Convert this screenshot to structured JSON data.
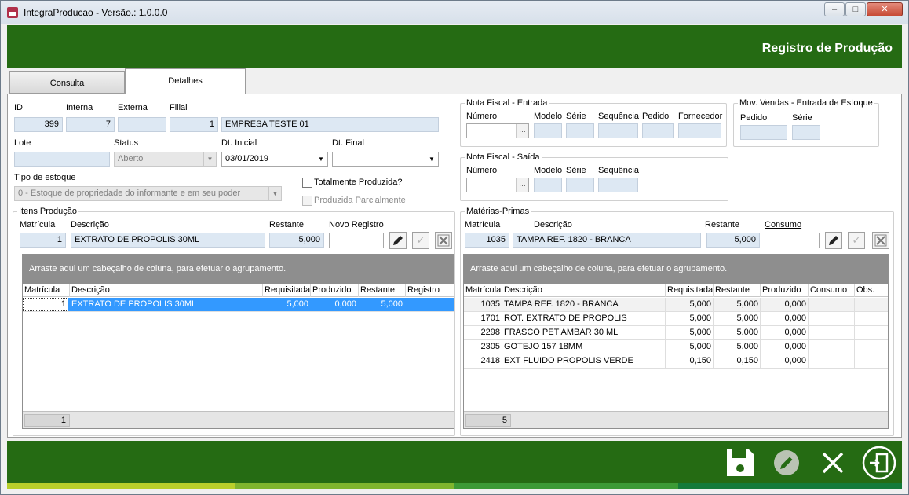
{
  "window": {
    "title": "IntegraProducao - Versão.: 1.0.0.0",
    "min": "–",
    "max": "□",
    "close": "✕"
  },
  "header": {
    "title": "Registro de Produção"
  },
  "tabs": [
    {
      "label": "Consulta"
    },
    {
      "label": "Detalhes"
    }
  ],
  "form": {
    "id": {
      "label": "ID",
      "value": "399"
    },
    "interna": {
      "label": "Interna",
      "value": "7"
    },
    "externa": {
      "label": "Externa",
      "value": ""
    },
    "filial": {
      "label": "Filial",
      "value": "1",
      "name": "EMPRESA TESTE 01"
    },
    "lote": {
      "label": "Lote",
      "value": ""
    },
    "status": {
      "label": "Status",
      "value": "Aberto"
    },
    "dt_inicial": {
      "label": "Dt. Inicial",
      "value": "03/01/2019"
    },
    "dt_final": {
      "label": "Dt. Final",
      "value": ""
    },
    "tipo_estoque": {
      "label": "Tipo de estoque",
      "value": "0 - Estoque de propriedade do informante e em seu poder"
    },
    "totalmente_produzida": "Totalmente Produzida?",
    "produzida_parcialmente": "Produzida Parcialmente"
  },
  "nf_entrada": {
    "title": "Nota Fiscal - Entrada",
    "labels": {
      "numero": "Número",
      "modelo": "Modelo",
      "serie": "Série",
      "sequencia": "Sequência",
      "pedido": "Pedido",
      "fornecedor": "Fornecedor"
    }
  },
  "mov_vendas": {
    "title": "Mov. Vendas - Entrada de Estoque",
    "labels": {
      "pedido": "Pedido",
      "serie": "Série"
    }
  },
  "nf_saida": {
    "title": "Nota Fiscal - Saída",
    "labels": {
      "numero": "Número",
      "modelo": "Modelo",
      "serie": "Série",
      "sequencia": "Sequência"
    }
  },
  "itens": {
    "title": "Itens Produção",
    "labels": {
      "matricula": "Matrícula",
      "descricao": "Descrição",
      "restante": "Restante",
      "novo_registro": "Novo Registro"
    },
    "edit": {
      "matricula": "1",
      "descricao": "EXTRATO DE PROPOLIS 30ML",
      "restante": "5,000",
      "novo_registro": ""
    },
    "group_hint": "Arraste aqui um cabeçalho de coluna, para efetuar o agrupamento.",
    "columns": [
      "Matrícula",
      "Descrição",
      "Requisitada",
      "Produzido",
      "Restante",
      "Registro"
    ],
    "rows": [
      {
        "matricula": "1",
        "descricao": "EXTRATO DE PROPOLIS 30ML",
        "requisitada": "5,000",
        "produzido": "0,000",
        "restante": "5,000",
        "registro": ""
      }
    ],
    "count": "1"
  },
  "materias": {
    "title": "Matérias-Primas",
    "labels": {
      "matricula": "Matrícula",
      "descricao": "Descrição",
      "restante": "Restante",
      "consumo": "Consumo"
    },
    "edit": {
      "matricula": "1035",
      "descricao": "TAMPA REF. 1820 - BRANCA",
      "restante": "5,000",
      "consumo": ""
    },
    "group_hint": "Arraste aqui um cabeçalho de coluna, para efetuar o agrupamento.",
    "columns": [
      "Matrícula",
      "Descrição",
      "Requisitada",
      "Restante",
      "Produzido",
      "Consumo",
      "Obs."
    ],
    "rows": [
      {
        "matricula": "1035",
        "descricao": "TAMPA REF. 1820 - BRANCA",
        "requisitada": "5,000",
        "restante": "5,000",
        "produzido": "0,000"
      },
      {
        "matricula": "1701",
        "descricao": "ROT. EXTRATO DE PROPOLIS",
        "requisitada": "5,000",
        "restante": "5,000",
        "produzido": "0,000"
      },
      {
        "matricula": "2298",
        "descricao": "FRASCO PET AMBAR 30 ML",
        "requisitada": "5,000",
        "restante": "5,000",
        "produzido": "0,000"
      },
      {
        "matricula": "2305",
        "descricao": "GOTEJO 157 18MM",
        "requisitada": "5,000",
        "restante": "5,000",
        "produzido": "0,000"
      },
      {
        "matricula": "2418",
        "descricao": "EXT FLUIDO PROPOLIS VERDE",
        "requisitada": "0,150",
        "restante": "0,150",
        "produzido": "0,000"
      }
    ],
    "count": "5"
  },
  "colors": {
    "brand_green": "#256b13",
    "selection": "#3399ff",
    "field_bg": "#dde8f3"
  },
  "icons": [
    "save-icon",
    "edit-icon",
    "close-icon",
    "exit-icon",
    "pencil-icon",
    "check-icon",
    "cancel-icon"
  ]
}
